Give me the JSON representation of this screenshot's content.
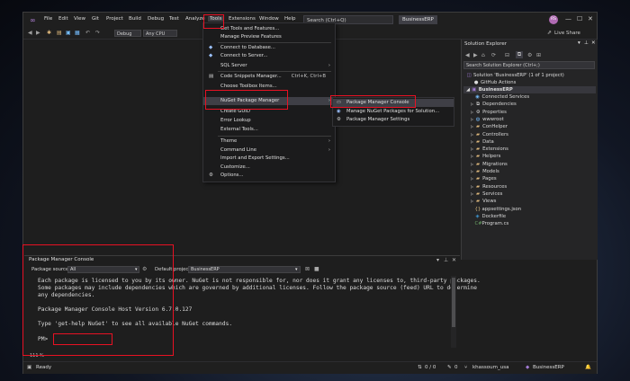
{
  "titlebar": {
    "menu": [
      "File",
      "Edit",
      "View",
      "Git",
      "Project",
      "Build",
      "Debug",
      "Test",
      "Analyze",
      "Tools",
      "Extensions",
      "Window",
      "Help"
    ],
    "search_placeholder": "Search (Ctrl+Q)",
    "project_name": "BusinessERP",
    "avatar_initials": "RS"
  },
  "toolbar": {
    "config": "Debug",
    "platform": "Any CPU",
    "live_share": "Live Share"
  },
  "tools_menu": {
    "items": [
      {
        "label": "Get Tools and Features...",
        "shortcut": "",
        "arrow": false
      },
      {
        "label": "Manage Preview Features",
        "shortcut": "",
        "arrow": false
      },
      {
        "label": "Connect to Database...",
        "shortcut": "",
        "arrow": false
      },
      {
        "label": "Connect to Server...",
        "shortcut": "",
        "arrow": false
      },
      {
        "label": "SQL Server",
        "shortcut": "",
        "arrow": true
      },
      {
        "label": "Code Snippets Manager...",
        "shortcut": "Ctrl+K, Ctrl+B",
        "arrow": false
      },
      {
        "label": "Choose Toolbox Items...",
        "shortcut": "",
        "arrow": false
      },
      {
        "label": "NuGet Package Manager",
        "shortcut": "",
        "arrow": true
      },
      {
        "label": "Create GUID",
        "shortcut": "",
        "arrow": false
      },
      {
        "label": "Error Lookup",
        "shortcut": "",
        "arrow": false
      },
      {
        "label": "External Tools...",
        "shortcut": "",
        "arrow": false
      },
      {
        "label": "Theme",
        "shortcut": "",
        "arrow": true
      },
      {
        "label": "Command Line",
        "shortcut": "",
        "arrow": true
      },
      {
        "label": "Import and Export Settings...",
        "shortcut": "",
        "arrow": false
      },
      {
        "label": "Customize...",
        "shortcut": "",
        "arrow": false
      },
      {
        "label": "Options...",
        "shortcut": "",
        "arrow": false
      }
    ]
  },
  "nuget_submenu": {
    "items": [
      {
        "label": "Package Manager Console"
      },
      {
        "label": "Manage NuGet Packages for Solution..."
      },
      {
        "label": "Package Manager Settings"
      }
    ]
  },
  "solution_explorer": {
    "title": "Solution Explorer",
    "search_placeholder": "Search Solution Explorer (Ctrl+;)",
    "solution_label": "Solution 'BusinessERP' (1 of 1 project)",
    "items": [
      {
        "label": "GitHub Actions",
        "icon": "github-icon"
      },
      {
        "label": "BusinessERP",
        "icon": "project-icon"
      },
      {
        "label": "Connected Services",
        "icon": "connected-services-icon"
      },
      {
        "label": "Dependencies",
        "icon": "dependencies-icon"
      },
      {
        "label": "Properties",
        "icon": "properties-icon"
      },
      {
        "label": "wwwroot",
        "icon": "globe-icon"
      },
      {
        "label": "ConHelper",
        "icon": "folder-icon"
      },
      {
        "label": "Controllers",
        "icon": "folder-icon"
      },
      {
        "label": "Data",
        "icon": "folder-icon"
      },
      {
        "label": "Extensions",
        "icon": "folder-icon"
      },
      {
        "label": "Helpers",
        "icon": "folder-icon"
      },
      {
        "label": "Migrations",
        "icon": "folder-icon"
      },
      {
        "label": "Models",
        "icon": "folder-icon"
      },
      {
        "label": "Pages",
        "icon": "folder-icon"
      },
      {
        "label": "Resources",
        "icon": "folder-icon"
      },
      {
        "label": "Services",
        "icon": "folder-icon"
      },
      {
        "label": "Views",
        "icon": "folder-icon"
      },
      {
        "label": "appsettings.json",
        "icon": "json-icon"
      },
      {
        "label": "Dockerfile",
        "icon": "docker-icon"
      },
      {
        "label": "Program.cs",
        "icon": "csharp-icon"
      }
    ]
  },
  "pmc": {
    "title": "Package Manager Console",
    "source_label": "Package source:",
    "source_value": "All",
    "project_label": "Default project:",
    "project_value": "BusinessERP",
    "lines": [
      "Each package is licensed to you by its owner. NuGet is not responsible for, nor does it grant any licenses to, third-party packages.",
      "Some packages may include dependencies which are governed by additional licenses. Follow the package source (feed) URL to determine",
      "any dependencies.",
      "Package Manager Console Host Version 6.7.0.127",
      "Type 'get-help NuGet' to see all available NuGet commands.",
      "PM>"
    ],
    "zoom": "111 %"
  },
  "statusbar": {
    "ready": "Ready",
    "position": "0 / 0",
    "pencil": "0",
    "branch_user": "khassoum_usa",
    "project": "BusinessERP"
  }
}
